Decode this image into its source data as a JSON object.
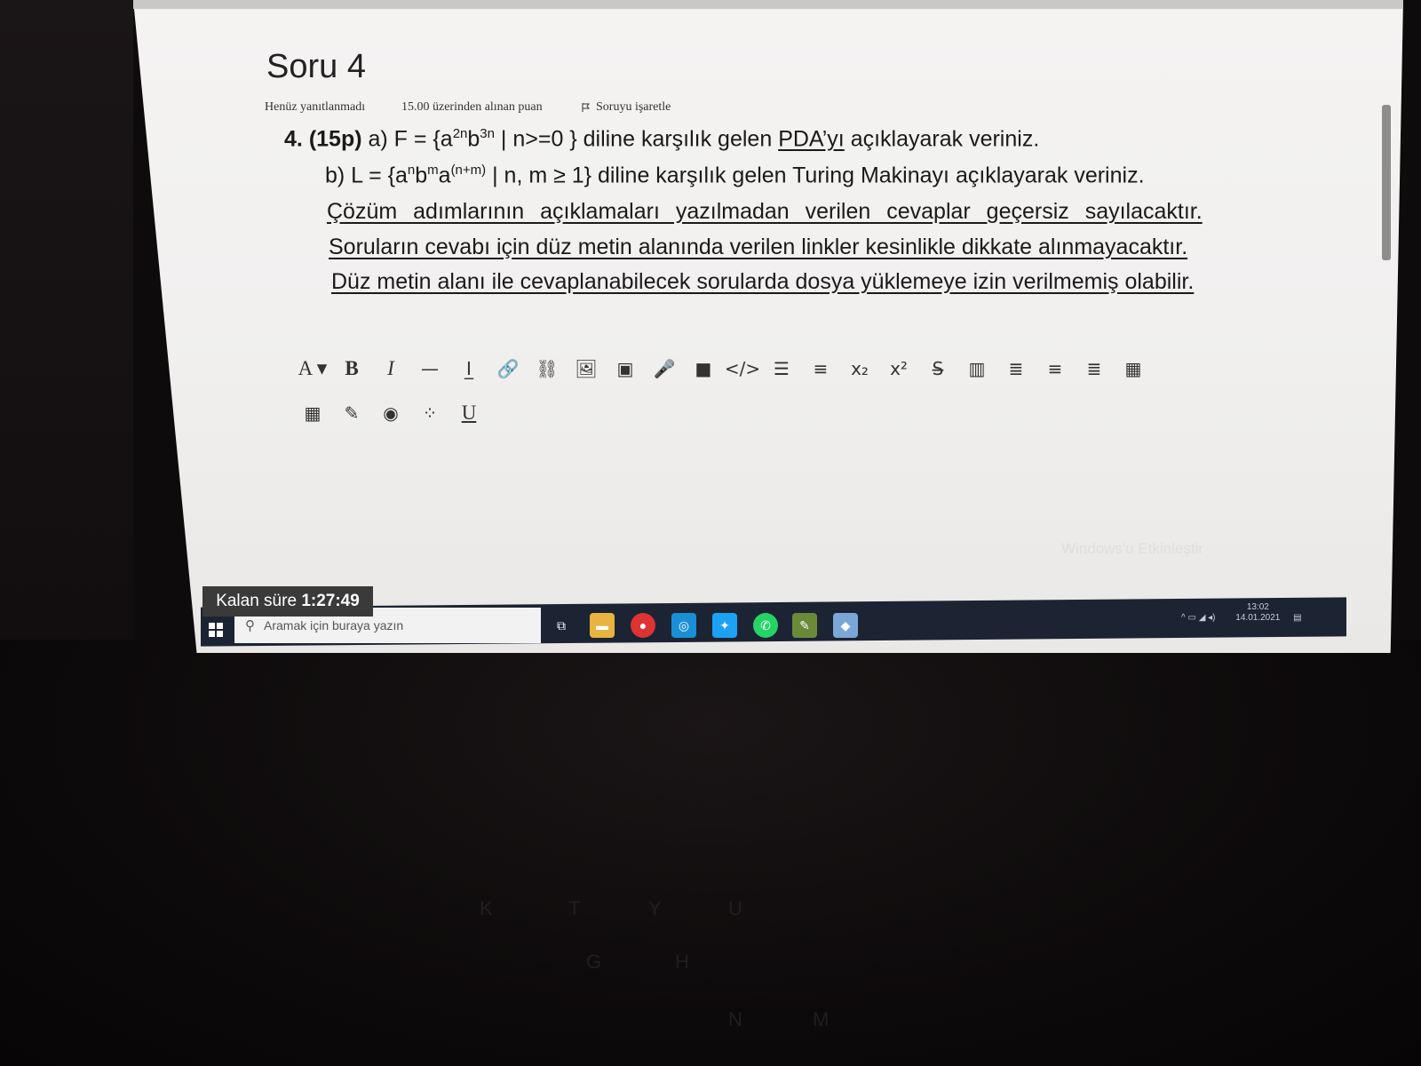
{
  "question": {
    "title": "Soru 4",
    "status": "Henüz yanıtlanmadı",
    "points": "15.00 üzerinden alınan puan",
    "flag_label": "Soruyu işaretle",
    "number": "4.",
    "score": "(15p)",
    "part_a_prefix": "a) F = {a",
    "part_a_exp1": "2n",
    "part_a_mid": "b",
    "part_a_exp2": "3n",
    "part_a_suffix": " | n>=0 } diline karşılık gelen ",
    "part_a_pda": "PDA’yı",
    "part_a_end": " açıklayarak veriniz.",
    "part_b_prefix": "b) L = {a",
    "part_b_exp1": "n",
    "part_b_b": "b",
    "part_b_exp2": "m",
    "part_b_a": "a",
    "part_b_exp3": "(n+m)",
    "part_b_suffix": " | n, m ≥ 1} diline karşılık gelen Turing Makinayı açıklayarak veriniz.",
    "note_1": "Çözüm adımlarının açıklamaları yazılmadan verilen cevaplar geçersiz sayılacaktır.",
    "note_2": "Soruların cevabı için düz metin alanında verilen linkler kesinlikle dikkate alınmayacaktır.",
    "note_3": "Düz metin alanı ile cevaplanabilecek sorularda dosya yüklemeye izin verilmemiş olabilir."
  },
  "editor": {
    "toolbar_row1": [
      {
        "name": "font-color-button",
        "glyph": "A ▾"
      },
      {
        "name": "bold-button",
        "glyph": "B"
      },
      {
        "name": "italic-button",
        "glyph": "I"
      },
      {
        "name": "horizontal-rule-button",
        "glyph": "—"
      },
      {
        "name": "clear-format-button",
        "glyph": "I̲"
      },
      {
        "name": "link-button",
        "glyph": "🔗"
      },
      {
        "name": "unlink-button",
        "glyph": "⛓"
      },
      {
        "name": "image-button",
        "glyph": "🖼"
      },
      {
        "name": "media-button",
        "glyph": "▣"
      },
      {
        "name": "record-audio-button",
        "glyph": "🎤"
      },
      {
        "name": "record-video-button",
        "glyph": "■"
      },
      {
        "name": "html-button",
        "glyph": "</>"
      },
      {
        "name": "bullet-list-button",
        "glyph": "☰"
      },
      {
        "name": "numbered-list-button",
        "glyph": "≡"
      },
      {
        "name": "subscript-button",
        "glyph": "x₂"
      },
      {
        "name": "superscript-button",
        "glyph": "x²"
      },
      {
        "name": "strikethrough-button",
        "glyph": "S̶"
      },
      {
        "name": "ltr-button",
        "glyph": "▥"
      },
      {
        "name": "align-left-button",
        "glyph": "≣"
      },
      {
        "name": "align-center-button",
        "glyph": "≡"
      },
      {
        "name": "align-right-button",
        "glyph": "≣"
      },
      {
        "name": "table-button",
        "glyph": "▦"
      }
    ],
    "toolbar_row2": [
      {
        "name": "equation-button",
        "glyph": "▦"
      },
      {
        "name": "edit-button",
        "glyph": "✎"
      },
      {
        "name": "accessibility-button",
        "glyph": "◉"
      },
      {
        "name": "special-chars-button",
        "glyph": "⁘"
      },
      {
        "name": "underline-button",
        "glyph": "U"
      }
    ]
  },
  "timer": {
    "label": "Kalan süre",
    "value": "1:27:49"
  },
  "taskbar": {
    "search_placeholder": "Aramak için buraya yazın",
    "time": "13:02",
    "date": "14.01.2021"
  },
  "watermark": "Windows'u Etkinleştir"
}
